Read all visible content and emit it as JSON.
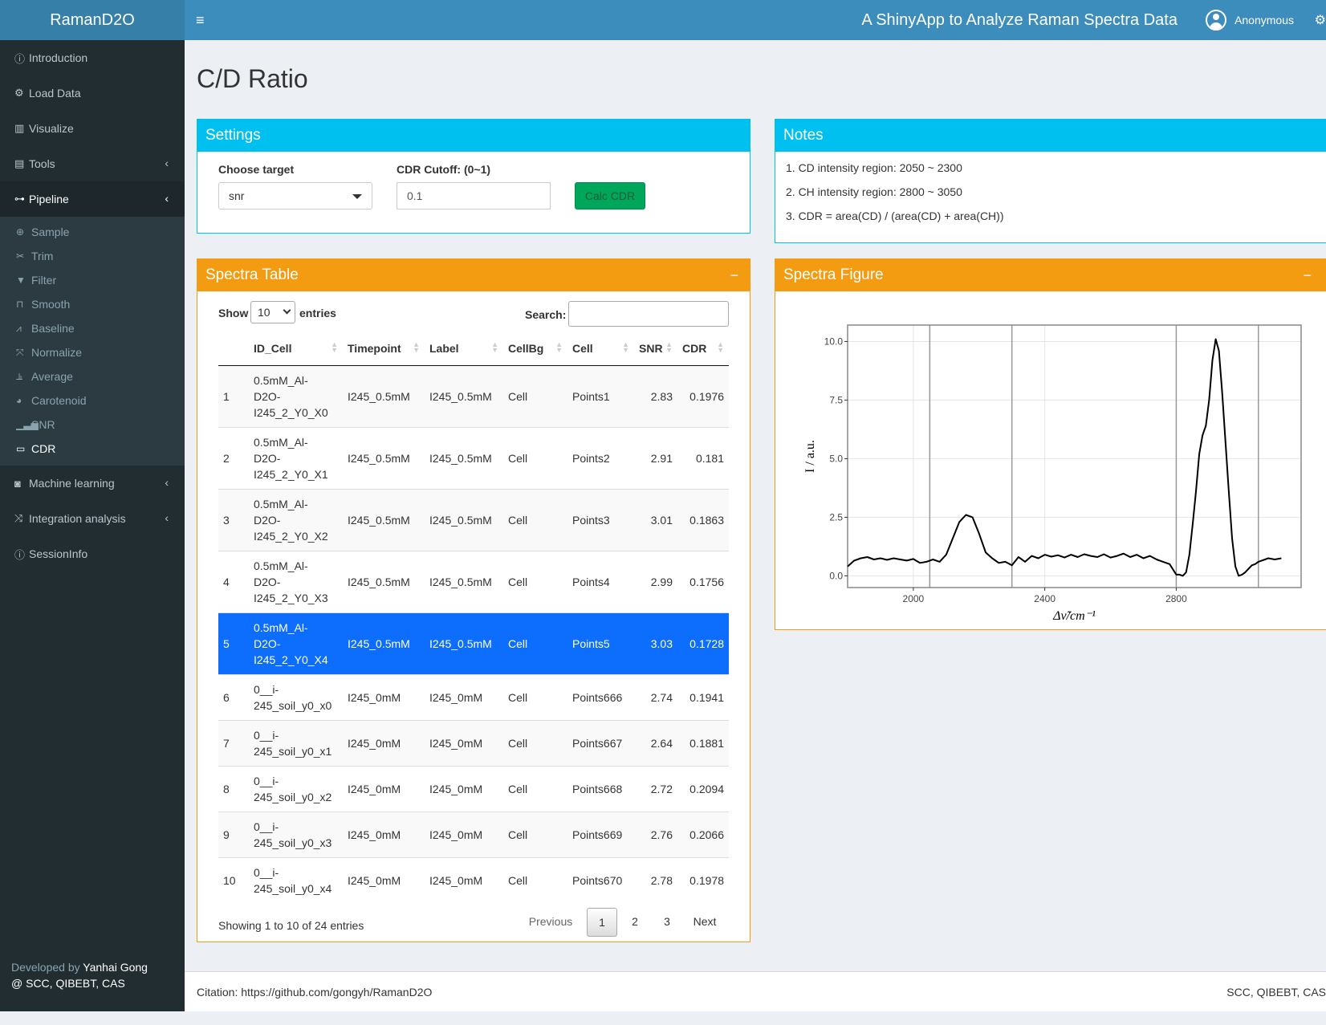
{
  "brand": "RamanD2O",
  "header": {
    "title": "A ShinyApp to Analyze Raman Spectra Data",
    "user": "Anonymous"
  },
  "sidebar": {
    "items": [
      {
        "label": "Introduction",
        "icon": "info-circle-icon"
      },
      {
        "label": "Load Data",
        "icon": "cogs-icon"
      },
      {
        "label": "Visualize",
        "icon": "bar-chart-icon"
      },
      {
        "label": "Tools",
        "icon": "toolbox-icon"
      },
      {
        "label": "Pipeline",
        "icon": "sitemap-icon"
      }
    ],
    "pipeline_sub": [
      {
        "label": "Sample",
        "icon": "crosshairs-icon"
      },
      {
        "label": "Trim",
        "icon": "scissors-icon"
      },
      {
        "label": "Filter",
        "icon": "filter-icon"
      },
      {
        "label": "Smooth",
        "icon": "wave-square-icon"
      },
      {
        "label": "Baseline",
        "icon": "line-chart-icon"
      },
      {
        "label": "Normalize",
        "icon": "compress-icon"
      },
      {
        "label": "Average",
        "icon": "chart-line-icon"
      },
      {
        "label": "Carotenoid",
        "icon": "palette-icon"
      },
      {
        "label": "SNR",
        "icon": "signal-icon"
      },
      {
        "label": "CDR",
        "icon": "toggle-icon"
      }
    ],
    "items_after": [
      {
        "label": "Machine learning",
        "icon": "robot-icon"
      },
      {
        "label": "Integration analysis",
        "icon": "random-icon"
      },
      {
        "label": "SessionInfo",
        "icon": "info-circle-icon"
      }
    ],
    "credit_prefix": "Developed by",
    "credit_name": "Yanhai Gong",
    "credit_org": "@ SCC, QIBEBT, CAS"
  },
  "page_title": "C/D Ratio",
  "settings": {
    "title": "Settings",
    "target_label": "Choose target",
    "target_value": "snr",
    "cutoff_label": "CDR Cutoff: (0~1)",
    "cutoff_value": "0.1",
    "button": "Calc CDR"
  },
  "notes": {
    "title": "Notes",
    "items": [
      "1. CD intensity region: 2050 ~ 2300",
      "2. CH intensity region: 2800 ~ 3050",
      "3. CDR = area(CD) / (area(CD) + area(CH))"
    ]
  },
  "table": {
    "title": "Spectra Table",
    "minimize": "−",
    "show": "Show",
    "entries": "entries",
    "length": "10",
    "search_label": "Search:",
    "columns": [
      "",
      "ID_Cell",
      "Timepoint",
      "Label",
      "CellBg",
      "Cell",
      "SNR",
      "CDR"
    ],
    "rows": [
      {
        "n": "1",
        "id": [
          "0.5mM_Al-",
          "D2O-",
          "I245_2_Y0_X0"
        ],
        "tp": "I245_0.5mM",
        "label": "I245_0.5mM",
        "bg": "Cell",
        "cell": "Points1",
        "snr": "2.83",
        "cdr": "0.1976"
      },
      {
        "n": "2",
        "id": [
          "0.5mM_Al-",
          "D2O-",
          "I245_2_Y0_X1"
        ],
        "tp": "I245_0.5mM",
        "label": "I245_0.5mM",
        "bg": "Cell",
        "cell": "Points2",
        "snr": "2.91",
        "cdr": "0.181"
      },
      {
        "n": "3",
        "id": [
          "0.5mM_Al-",
          "D2O-",
          "I245_2_Y0_X2"
        ],
        "tp": "I245_0.5mM",
        "label": "I245_0.5mM",
        "bg": "Cell",
        "cell": "Points3",
        "snr": "3.01",
        "cdr": "0.1863"
      },
      {
        "n": "4",
        "id": [
          "0.5mM_Al-",
          "D2O-",
          "I245_2_Y0_X3"
        ],
        "tp": "I245_0.5mM",
        "label": "I245_0.5mM",
        "bg": "Cell",
        "cell": "Points4",
        "snr": "2.99",
        "cdr": "0.1756"
      },
      {
        "n": "5",
        "id": [
          "0.5mM_Al-",
          "D2O-",
          "I245_2_Y0_X4"
        ],
        "tp": "I245_0.5mM",
        "label": "I245_0.5mM",
        "bg": "Cell",
        "cell": "Points5",
        "snr": "3.03",
        "cdr": "0.1728",
        "selected": true
      },
      {
        "n": "6",
        "id": [
          "0__i-",
          "245_soil_y0_x0"
        ],
        "tp": "I245_0mM",
        "label": "I245_0mM",
        "bg": "Cell",
        "cell": "Points666",
        "snr": "2.74",
        "cdr": "0.1941"
      },
      {
        "n": "7",
        "id": [
          "0__i-",
          "245_soil_y0_x1"
        ],
        "tp": "I245_0mM",
        "label": "I245_0mM",
        "bg": "Cell",
        "cell": "Points667",
        "snr": "2.64",
        "cdr": "0.1881"
      },
      {
        "n": "8",
        "id": [
          "0__i-",
          "245_soil_y0_x2"
        ],
        "tp": "I245_0mM",
        "label": "I245_0mM",
        "bg": "Cell",
        "cell": "Points668",
        "snr": "2.72",
        "cdr": "0.2094"
      },
      {
        "n": "9",
        "id": [
          "0__i-",
          "245_soil_y0_x3"
        ],
        "tp": "I245_0mM",
        "label": "I245_0mM",
        "bg": "Cell",
        "cell": "Points669",
        "snr": "2.76",
        "cdr": "0.2066"
      },
      {
        "n": "10",
        "id": [
          "0__i-",
          "245_soil_y0_x4"
        ],
        "tp": "I245_0mM",
        "label": "I245_0mM",
        "bg": "Cell",
        "cell": "Points670",
        "snr": "2.78",
        "cdr": "0.1978"
      }
    ],
    "info": "Showing 1 to 10 of 24 entries",
    "pagination": [
      "Previous",
      "1",
      "2",
      "3",
      "Next"
    ]
  },
  "figure": {
    "title": "Spectra Figure",
    "minimize": "−"
  },
  "chart_data": {
    "type": "line",
    "xlabel": "Δν̃/cm⁻¹",
    "ylabel": "I / a.u.",
    "xlim": [
      1800,
      3180
    ],
    "ylim": [
      -0.5,
      10.7
    ],
    "xticks": [
      2000,
      2400,
      2800
    ],
    "yticks": [
      "0.0",
      "2.5",
      "5.0",
      "7.5",
      "10.0"
    ],
    "yticks_values": [
      0,
      2.5,
      5,
      7.5,
      10
    ],
    "region_lines": [
      2050,
      2300,
      2800,
      3050
    ],
    "grid": true,
    "series": [
      {
        "x": [
          1800,
          1820,
          1840,
          1860,
          1880,
          1900,
          1920,
          1940,
          1960,
          1980,
          2000,
          2020,
          2040,
          2060,
          2080,
          2100,
          2120,
          2140,
          2160,
          2180,
          2200,
          2210,
          2220,
          2240,
          2260,
          2280,
          2300,
          2320,
          2340,
          2360,
          2380,
          2400,
          2420,
          2440,
          2460,
          2480,
          2500,
          2520,
          2540,
          2560,
          2580,
          2600,
          2620,
          2640,
          2660,
          2680,
          2700,
          2720,
          2740,
          2760,
          2780,
          2800,
          2810,
          2820,
          2830,
          2840,
          2850,
          2860,
          2870,
          2880,
          2890,
          2900,
          2910,
          2920,
          2930,
          2940,
          2950,
          2960,
          2970,
          2980,
          2990,
          3000,
          3010,
          3020,
          3030,
          3040,
          3050,
          3060,
          3070,
          3080,
          3100,
          3120
        ],
        "y": [
          0.4,
          0.65,
          0.75,
          0.8,
          0.7,
          0.75,
          0.68,
          0.75,
          0.7,
          0.65,
          0.72,
          0.55,
          0.6,
          0.7,
          0.6,
          0.9,
          1.6,
          2.3,
          2.6,
          2.5,
          1.8,
          1.4,
          1.0,
          0.75,
          0.55,
          0.6,
          0.45,
          0.8,
          0.6,
          0.85,
          0.75,
          0.9,
          0.82,
          0.88,
          0.78,
          0.9,
          0.8,
          0.92,
          0.85,
          0.8,
          0.92,
          0.78,
          0.85,
          0.95,
          0.8,
          0.9,
          0.75,
          0.85,
          0.7,
          0.6,
          0.5,
          0.05,
          0.05,
          0.0,
          0.15,
          0.9,
          2.2,
          3.6,
          5.2,
          6.0,
          6.4,
          7.5,
          9.2,
          10.1,
          9.6,
          7.8,
          5.7,
          3.6,
          1.6,
          0.4,
          0.0,
          0.05,
          0.15,
          0.3,
          0.45,
          0.5,
          0.6,
          0.65,
          0.7,
          0.75,
          0.7,
          0.75
        ]
      }
    ]
  },
  "footer": {
    "citation": "Citation: https://github.com/gongyh/RamanD2O",
    "org": "SCC, QIBEBT, CAS"
  }
}
